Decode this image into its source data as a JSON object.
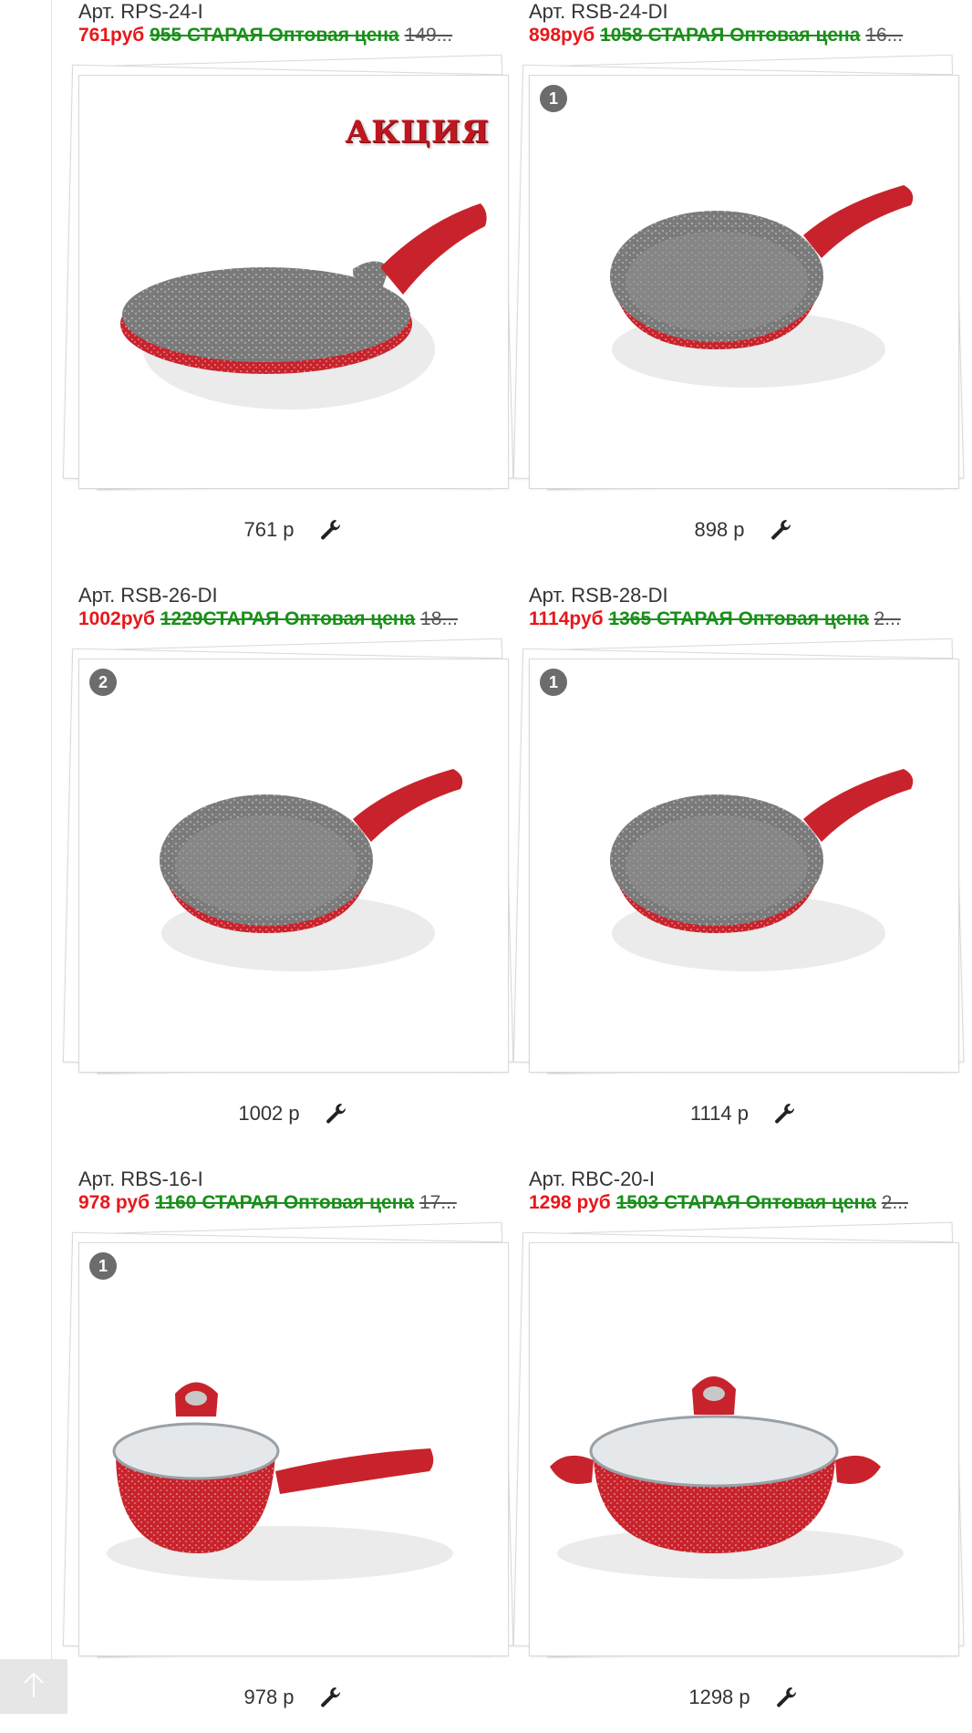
{
  "products": [
    {
      "art": "Арт. RPS-24-I",
      "price_new": "761руб",
      "price_old": "955 СТАРАЯ Оптовая цена",
      "price_rrp": "149...",
      "badge": "",
      "promo": "АКЦИЯ",
      "bottom_price": "761 р",
      "kind": "crepe"
    },
    {
      "art": "Арт. RSB-24-DI",
      "price_new": "898руб",
      "price_old": "1058 СТАРАЯ Оптовая цена",
      "price_rrp": "16...",
      "badge": "1",
      "promo": "",
      "bottom_price": "898 р",
      "kind": "pan"
    },
    {
      "art": "Арт. RSB-26-DI",
      "price_new": "1002руб",
      "price_old": "1229СТАРАЯ Оптовая цена",
      "price_rrp": "18...",
      "badge": "2",
      "promo": "",
      "bottom_price": "1002 р",
      "kind": "pan"
    },
    {
      "art": "Арт. RSB-28-DI",
      "price_new": "1114руб",
      "price_old": "1365 СТАРАЯ Оптовая цена",
      "price_rrp": "2...",
      "badge": "1",
      "promo": "",
      "bottom_price": "1114 р",
      "kind": "pan"
    },
    {
      "art": "Арт. RBS-16-I",
      "price_new": "978 руб",
      "price_old": "1160 СТАРАЯ Оптовая цена",
      "price_rrp": "17...",
      "badge": "1",
      "promo": "",
      "bottom_price": "978 р",
      "kind": "saucepan"
    },
    {
      "art": "Арт. RBC-20-I",
      "price_new": "1298 руб",
      "price_old": "1503 СТАРАЯ Оптовая цена",
      "price_rrp": "2...",
      "badge": "",
      "promo": "",
      "bottom_price": "1298 р",
      "kind": "casserole"
    }
  ],
  "colors": {
    "price_new": "#e8171a",
    "price_old": "#1a8f1a",
    "pan_red": "#c8232c",
    "pan_gray": "#7b7b7b"
  },
  "icons": {
    "service": "wrench-icon",
    "scroll": "arrow-up-icon"
  }
}
